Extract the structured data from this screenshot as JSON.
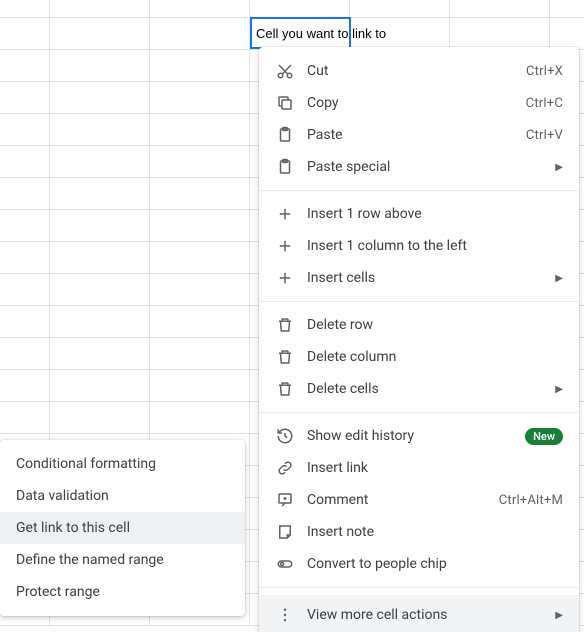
{
  "active_cell": {
    "text": "Cell you want to link to"
  },
  "menu": {
    "sections": [
      [
        {
          "icon": "cut",
          "label": "Cut",
          "shortcut": "Ctrl+X"
        },
        {
          "icon": "copy",
          "label": "Copy",
          "shortcut": "Ctrl+C"
        },
        {
          "icon": "paste",
          "label": "Paste",
          "shortcut": "Ctrl+V"
        },
        {
          "icon": "paste",
          "label": "Paste special",
          "submenu": true
        }
      ],
      [
        {
          "icon": "plus",
          "label": "Insert 1 row above"
        },
        {
          "icon": "plus",
          "label": "Insert 1 column to the left"
        },
        {
          "icon": "plus",
          "label": "Insert cells",
          "submenu": true
        }
      ],
      [
        {
          "icon": "trash",
          "label": "Delete row"
        },
        {
          "icon": "trash",
          "label": "Delete column"
        },
        {
          "icon": "trash",
          "label": "Delete cells",
          "submenu": true
        }
      ],
      [
        {
          "icon": "history",
          "label": "Show edit history",
          "badge": "New"
        },
        {
          "icon": "link",
          "label": "Insert link"
        },
        {
          "icon": "comment",
          "label": "Comment",
          "shortcut": "Ctrl+Alt+M"
        },
        {
          "icon": "note",
          "label": "Insert note"
        },
        {
          "icon": "people",
          "label": "Convert to people chip"
        }
      ]
    ],
    "view_more": {
      "icon": "more-vert",
      "label": "View more cell actions",
      "submenu": true
    }
  },
  "submenu": {
    "items": [
      {
        "label": "Conditional formatting"
      },
      {
        "label": "Data validation"
      },
      {
        "label": "Get link to this cell",
        "hover": true
      },
      {
        "label": "Define the named range"
      },
      {
        "label": "Protect range"
      }
    ]
  }
}
